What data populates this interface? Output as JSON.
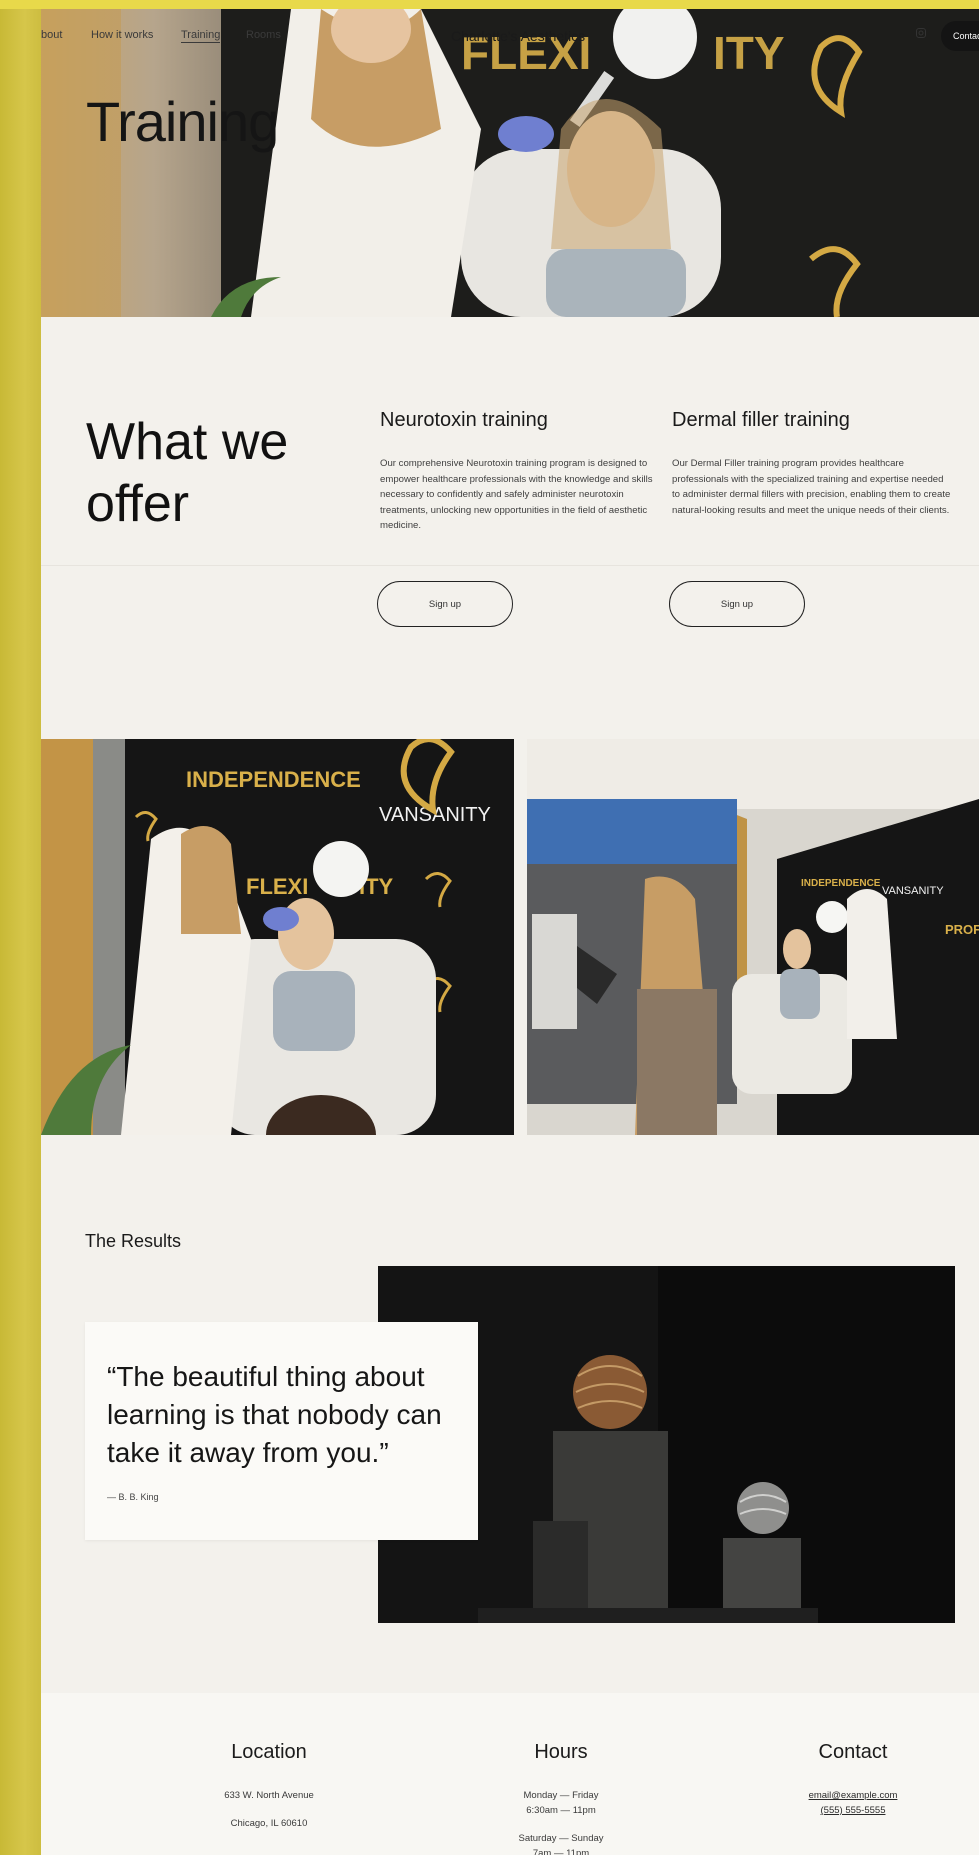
{
  "nav": {
    "items": [
      "bout",
      "How it works",
      "Training",
      "Rooms"
    ],
    "active": "Training",
    "brand": "Charlotte's Aesthetics",
    "contact_label": "Contac"
  },
  "hero": {
    "title": "Training",
    "backdrop_text": "FLEXI",
    "backdrop_text_2": "ITY"
  },
  "offer": {
    "title_line1": "What we",
    "title_line2": "offer",
    "items": [
      {
        "title": "Neurotoxin training",
        "description": "Our comprehensive Neurotoxin training program is designed to empower healthcare professionals with the knowledge and skills necessary to confidently and safely administer neurotoxin treatments, unlocking new opportunities in the field of aesthetic medicine.",
        "button": "Sign up"
      },
      {
        "title": "Dermal filler training",
        "description": "Our Dermal Filler training program provides healthcare professionals with the specialized training and expertise needed to administer dermal fillers with precision, enabling them to create natural-looking results and meet the unique needs of their clients.",
        "button": "Sign up"
      }
    ]
  },
  "photos": {
    "left_words": [
      "INDEPENDENCE",
      "VANSANITY",
      "FLEXI",
      "ITY"
    ],
    "right_words": [
      "INDEPENDENCE",
      "VANSANITY",
      "PROF"
    ]
  },
  "results": {
    "label": "The Results",
    "quote": "“The beautiful thing about learning is that nobody can take it away from you.”",
    "author": "— B. B. King"
  },
  "footer": {
    "location": {
      "title": "Location",
      "lines": [
        "633 W. North Avenue",
        "Chicago, IL 60610"
      ]
    },
    "hours": {
      "title": "Hours",
      "weekday_label": "Monday — Friday",
      "weekday_time": "6:30am — 11pm",
      "weekend_label": "Saturday — Sunday",
      "weekend_time": "7am — 11pm"
    },
    "contact": {
      "title": "Contact",
      "email": "email@example.com",
      "phone": "(555) 555-5555"
    }
  },
  "colors": {
    "accent_yellow": "#d1c143",
    "gold_text": "#d9b04a",
    "page_bg": "#f3f1ec",
    "dark": "#141414"
  }
}
